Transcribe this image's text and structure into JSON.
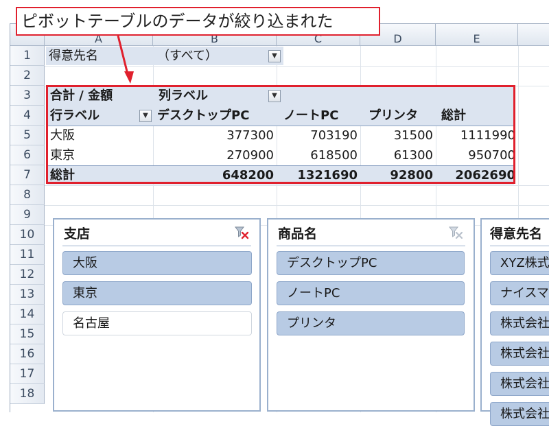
{
  "annotation": {
    "label": "ピボットテーブルのデータが絞り込まれた"
  },
  "columns": [
    "A",
    "B",
    "C",
    "D",
    "E"
  ],
  "rows": [
    "1",
    "2",
    "3",
    "4",
    "5",
    "6",
    "7",
    "8",
    "9",
    "10",
    "11",
    "12",
    "13",
    "14",
    "15",
    "16",
    "17",
    "18"
  ],
  "filter": {
    "label": "得意先名",
    "value": "（すべて）",
    "dropdown_glyph": "▼"
  },
  "pivot": {
    "corner_label": "合計 / 金額",
    "col_labels_header": "列ラベル",
    "row_labels_header": "行ラベル",
    "col_headers": [
      "デスクトップPC",
      "ノートPC",
      "プリンタ",
      "総計"
    ],
    "rows": [
      {
        "label": "大阪",
        "values": [
          "377300",
          "703190",
          "31500",
          "1111990"
        ]
      },
      {
        "label": "東京",
        "values": [
          "270900",
          "618500",
          "61300",
          "950700"
        ]
      }
    ],
    "total": {
      "label": "総計",
      "values": [
        "648200",
        "1321690",
        "92800",
        "2062690"
      ]
    },
    "dropdown_glyph": "▼",
    "filter_glyph": "▼"
  },
  "slicers": [
    {
      "title": "支店",
      "items": [
        {
          "label": "大阪",
          "selected": true
        },
        {
          "label": "東京",
          "selected": true
        },
        {
          "label": "名古屋",
          "selected": false
        }
      ],
      "clear_filter_active": true
    },
    {
      "title": "商品名",
      "items": [
        {
          "label": "デスクトップPC",
          "selected": true
        },
        {
          "label": "ノートPC",
          "selected": true
        },
        {
          "label": "プリンタ",
          "selected": true
        }
      ],
      "clear_filter_active": false
    },
    {
      "title": "得意先名",
      "items": [
        {
          "label": "XYZ株式会社",
          "selected": true
        },
        {
          "label": "ナイスマート",
          "selected": true
        },
        {
          "label": "株式会社",
          "selected": true
        },
        {
          "label": "株式会社",
          "selected": true
        },
        {
          "label": "株式会社",
          "selected": true
        },
        {
          "label": "株式会社",
          "selected": true
        }
      ],
      "clear_filter_active": false
    }
  ],
  "colors": {
    "accent_red": "#e0202d",
    "slicer_selected": "#b8cbe4",
    "pivot_band": "#dce4f0"
  }
}
